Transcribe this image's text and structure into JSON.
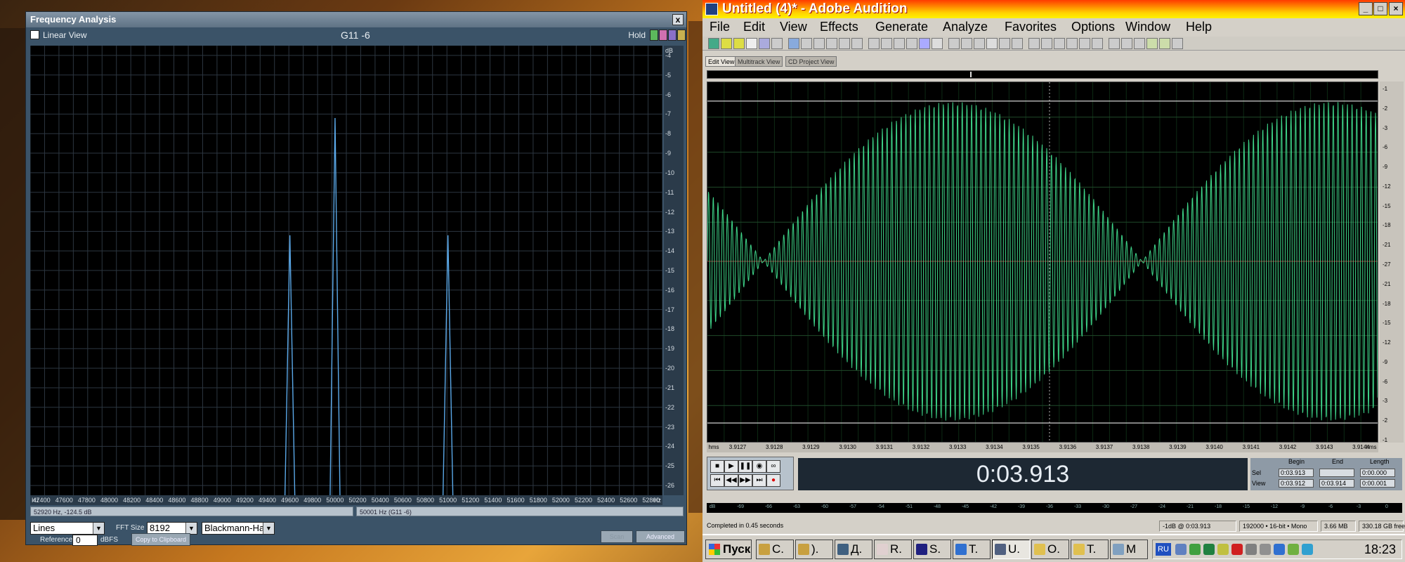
{
  "freq_window": {
    "title": "Frequency Analysis",
    "close_label": "x",
    "linear_view_label": "Linear View",
    "graph_title": "G11 -6",
    "hold_label": "Hold",
    "db_unit": "dB",
    "db_labels": [
      "-4",
      "-5",
      "-6",
      "-7",
      "-8",
      "-9",
      "-10",
      "-11",
      "-12",
      "-13",
      "-14",
      "-15",
      "-16",
      "-17",
      "-18",
      "-19",
      "-20",
      "-21",
      "-22",
      "-23",
      "-24",
      "-25",
      "-26"
    ],
    "x_unit": "Hz",
    "x_labels": [
      "47400",
      "47600",
      "47800",
      "48000",
      "48200",
      "48400",
      "48600",
      "48800",
      "49000",
      "49200",
      "49400",
      "49600",
      "49800",
      "50000",
      "50200",
      "50400",
      "50600",
      "50800",
      "51000",
      "51200",
      "51400",
      "51600",
      "51800",
      "52000",
      "52200",
      "52400",
      "52600",
      "52800"
    ],
    "status_left": "52920 Hz, -124.5 dB",
    "status_right": "50001 Hz (G11 -6)",
    "plot_mode": "Lines",
    "fft_size_label": "FFT Size",
    "fft_size": "8192",
    "window_func": "Blackmann-Har",
    "reference_label": "Reference",
    "reference_value": "0",
    "reference_unit": "dBFS",
    "copy_label": "Copy to Clipboard",
    "scan_label": "Scan",
    "advanced_label": "Advanced",
    "peaks": [
      {
        "freq_hz": 49600,
        "db": -13.2
      },
      {
        "freq_hz": 50000,
        "db": -7.2
      },
      {
        "freq_hz": 51000,
        "db": -13.2
      }
    ],
    "x_range": [
      47300,
      52900
    ],
    "db_range": [
      -3.5,
      -26.5
    ]
  },
  "audition": {
    "title": "Untitled (4)* - Adobe Audition",
    "menu": [
      "File",
      "Edit",
      "View",
      "Effects",
      "Generate",
      "Analyze",
      "Favorites",
      "Options",
      "Window",
      "Help"
    ],
    "tabs": [
      "Edit View",
      "Multitrack View",
      "CD Project View"
    ],
    "db_scale": [
      "-1",
      "-2",
      "-3",
      "-6",
      "-9",
      "-12",
      "-15",
      "-18",
      "-21",
      "-27",
      "-21",
      "-18",
      "-15",
      "-12",
      "-9",
      "-6",
      "-3",
      "-2",
      "-1"
    ],
    "time_labels": [
      "hms",
      "3.9127",
      "3.9128",
      "3.9129",
      "3.9130",
      "3.9131",
      "3.9132",
      "3.9133",
      "3.9134",
      "3.9135",
      "3.9136",
      "3.9137",
      "3.9138",
      "3.9139",
      "3.9140",
      "3.9141",
      "3.9142",
      "3.9143",
      "3.9144",
      "hms"
    ],
    "time_display": "0:03.913",
    "sel_headers": {
      "begin": "Begin",
      "end": "End",
      "length": "Length"
    },
    "sel_row": {
      "label": "Sel",
      "begin": "0:03.913",
      "end": "",
      "length": "0:00.000"
    },
    "view_row": {
      "label": "View",
      "begin": "0:03.912",
      "end": "0:03.914",
      "length": "0:00.001"
    },
    "level_labels": [
      "dB",
      "-69",
      "-66",
      "-63",
      "-60",
      "-57",
      "-54",
      "-51",
      "-48",
      "-45",
      "-42",
      "-39",
      "-36",
      "-33",
      "-30",
      "-27",
      "-24",
      "-21",
      "-18",
      "-15",
      "-12",
      "-9",
      "-6",
      "-3",
      "0"
    ],
    "status": {
      "completed": "Completed in 0.45 seconds",
      "peak": "-1dB @  0:03.913",
      "format": "192000 • 16-bit • Mono",
      "size": "3.66 MB",
      "free": "330.18 GB free"
    }
  },
  "taskbar": {
    "start_label": "Пуск",
    "tasks": [
      "C.",
      ").",
      "Д.",
      "R.",
      "S.",
      "T.",
      "U.",
      "O.",
      "T.",
      "M"
    ],
    "lang": "RU",
    "clock": "18:23"
  },
  "colors": {
    "spectrum_line": "#5aa8e8",
    "waveform": "#3fd68a",
    "grid_dark": "#1f3a24",
    "audition_title_start": "#ff3b00",
    "audition_title_end": "#fff200"
  }
}
